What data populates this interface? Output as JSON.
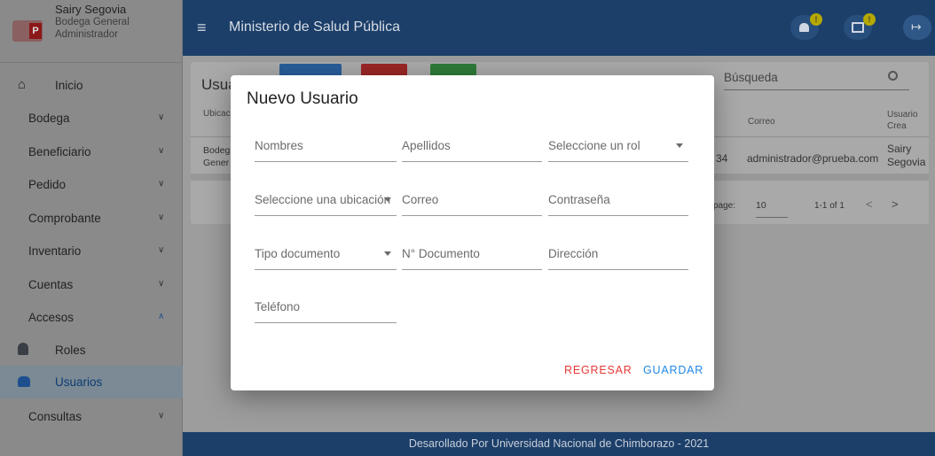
{
  "user": {
    "name": "Sairy Segovia",
    "warehouse": "Bodega General",
    "role": "Administrador"
  },
  "sidebar": {
    "items": [
      {
        "label": "Inicio"
      },
      {
        "label": "Bodega"
      },
      {
        "label": "Beneficiario"
      },
      {
        "label": "Pedido"
      },
      {
        "label": "Comprobante"
      },
      {
        "label": "Inventario"
      },
      {
        "label": "Cuentas"
      },
      {
        "label": "Accesos"
      },
      {
        "label": "Roles"
      },
      {
        "label": "Usuarios"
      },
      {
        "label": "Consultas"
      }
    ]
  },
  "header": {
    "title": "Ministerio de Salud Pública",
    "badge": "!"
  },
  "background": {
    "card_title": "Usua",
    "search_placeholder": "Búsqueda",
    "columns": {
      "ubicacion": "Ubicaci",
      "correo": "Correo",
      "usuario_crea": "Usuario\nCrea"
    },
    "row": {
      "ubicacion": "Bodeg\nGener",
      "num": "34",
      "correo": "administrador@prueba.com",
      "creador": "Sairy\nSegovia"
    },
    "pagination": {
      "rows_label": "page:",
      "rows_value": "10",
      "range": "1-1 of 1"
    }
  },
  "modal": {
    "title": "Nuevo Usuario",
    "fields": {
      "nombres": "Nombres",
      "apellidos": "Apellidos",
      "rol": "Seleccione un rol",
      "ubicacion": "Seleccione una ubicación",
      "correo": "Correo",
      "contrasena": "Contraseña",
      "tipo_doc": "Tipo documento",
      "num_doc": "N° Documento",
      "direccion": "Dirección",
      "telefono": "Teléfono"
    },
    "buttons": {
      "back": "REGRESAR",
      "save": "GUARDAR"
    }
  },
  "footer": {
    "text": "Desarollado Por Universidad Nacional de Chimborazo - 2021"
  },
  "colors": {
    "primary": "#2b6cb0",
    "danger": "#e53935",
    "save": "#1e88e5"
  }
}
